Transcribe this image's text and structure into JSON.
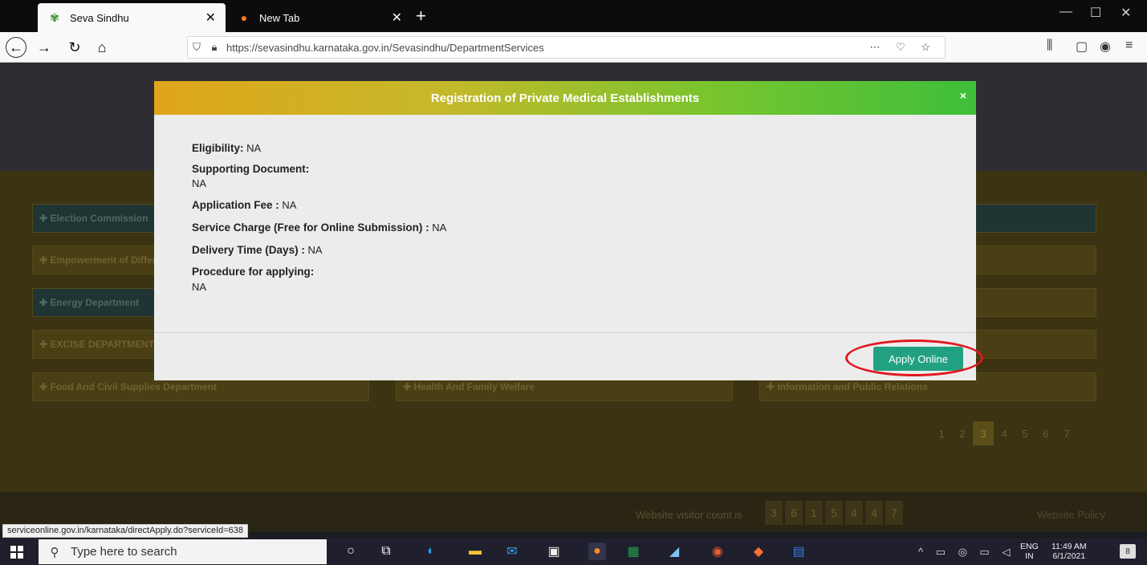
{
  "browser": {
    "tabs": [
      {
        "label": "Seva Sindhu",
        "icon": "seva-sindhu-logo-icon"
      },
      {
        "label": "New Tab",
        "icon": "firefox-icon"
      }
    ],
    "url": "https://sevasindhu.karnataka.gov.in/Sevasindhu/DepartmentServices",
    "status_url": "serviceonline.gov.in/karnataka/directApply.do?serviceId=638"
  },
  "page": {
    "departments": [
      "Election Commission",
      "Empowerment of Differently Abled",
      "Energy Department",
      "EXCISE DEPARTMENT",
      "Food And Civil Supplies Department",
      "Health And Family Welfare",
      "Information and Public Relations"
    ],
    "pagination": [
      "1",
      "2",
      "3",
      "4",
      "5",
      "6",
      "7"
    ],
    "current_page": "3",
    "visitor_label": "Website visitor count is",
    "visitor_digits": [
      "3",
      "6",
      "1",
      "5",
      "4",
      "4",
      "7"
    ],
    "policy_link": "Website Policy"
  },
  "modal": {
    "title": "Registration of Private Medical Establishments",
    "close": "×",
    "eligibility_label": "Eligibility:",
    "eligibility_value": " NA",
    "supporting_label": "Supporting Document:",
    "supporting_value": "NA",
    "fee_label": "Application Fee :",
    "fee_value": " NA",
    "service_charge_label": "Service Charge (Free for Online Submission) :",
    "service_charge_value": " NA",
    "delivery_label": "Delivery Time (Days) :",
    "delivery_value": " NA",
    "procedure_label": "Procedure for applying:",
    "procedure_value": "NA",
    "apply_button": "Apply Online"
  },
  "taskbar": {
    "search_placeholder": "Type here to search",
    "lang_top": "ENG",
    "lang_bottom": "IN",
    "time": "11:49 AM",
    "date": "6/1/2021",
    "notifications": "8"
  }
}
